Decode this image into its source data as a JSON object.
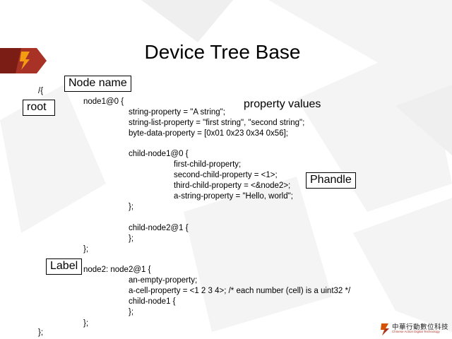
{
  "slide": {
    "title": "Device Tree Base",
    "code_lines": [
      "/{",
      "node1@0 {",
      "string-property = \"A string\";",
      "string-list-property = \"first string\", \"second string\";",
      "byte-data-property = [0x01 0x23 0x34 0x56];",
      "child-node1@0 {",
      "first-child-property;",
      "second-child-property = <1>;",
      "third-child-property = <&node2>;",
      "a-string-property = \"Hello, world\";",
      "};",
      "child-node2@1 {",
      "};",
      "};",
      "node2: node2@1 {",
      "an-empty-property;",
      "a-cell-property = <1 2 3 4>; /* each number (cell) is a uint32 */",
      "child-node1 {",
      "};",
      "};",
      "};"
    ],
    "callouts": {
      "node_name": "Node name",
      "root": "root",
      "property_values": "property values",
      "phandle": "Phandle",
      "label": "Label"
    },
    "footer": {
      "company_cn": "中華行動數位科技",
      "company_en": "Chinese Action Digital Technology"
    },
    "colors": {
      "accent": "#c0392b",
      "accent_dark": "#8e1f16",
      "accent_orange": "#e8842a"
    }
  }
}
